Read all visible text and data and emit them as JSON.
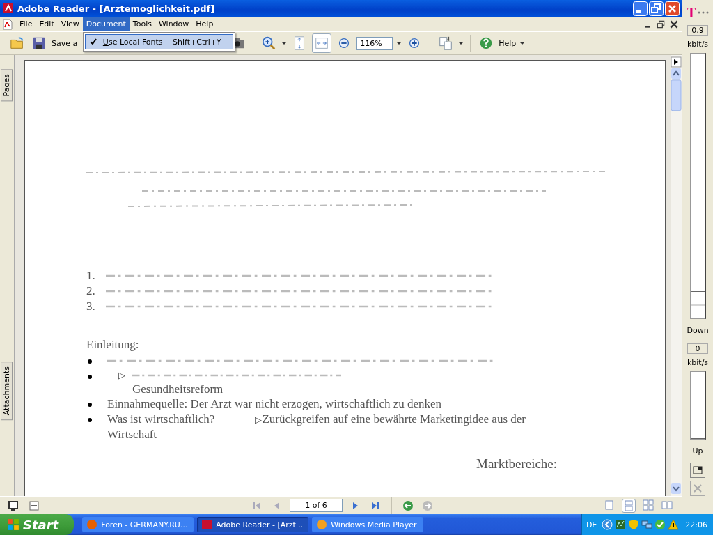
{
  "window": {
    "title": "Adobe Reader - [Arztemoglichkeit.pdf]"
  },
  "menu": [
    {
      "label": "File",
      "selected": false
    },
    {
      "label": "Edit",
      "selected": false
    },
    {
      "label": "View",
      "selected": false
    },
    {
      "label": "Document",
      "selected": true
    },
    {
      "label": "Tools",
      "selected": false
    },
    {
      "label": "Window",
      "selected": false
    },
    {
      "label": "Help",
      "selected": false
    }
  ],
  "dropdown": {
    "items": [
      {
        "label": "Use Local Fonts",
        "shortcut": "Shift+Ctrl+Y",
        "checked": true
      }
    ]
  },
  "toolbar": {
    "save_label": "Save a",
    "zoom": "116%",
    "help": "Help"
  },
  "side_tabs": [
    "Pages",
    "Attachments"
  ],
  "document": {
    "numbers": [
      "1.",
      "2.",
      "3."
    ],
    "heading": "Einleitung:",
    "bullets": [
      {
        "kind": "faded"
      },
      {
        "kind": "note",
        "arrow": "▷",
        "note": "Gesundheitsreform"
      },
      {
        "kind": "text",
        "text": "Einnahmequelle: Der Arzt war nicht erzogen, wirtschaftlich zu denken"
      },
      {
        "kind": "split",
        "text": "Was ist wirtschaftlich?",
        "arrow": "▷",
        "continuation": "Zurückgreifen auf eine bewährte Marketingidee aus der",
        "wrap": "Wirtschaft"
      }
    ],
    "right_heading": "Marktbereiche:"
  },
  "pager": {
    "page": "1 of 6"
  },
  "meter": {
    "brand": "T",
    "down": {
      "reading": "0,9",
      "unit": "kbit/s",
      "label": "Down",
      "level": 0.1
    },
    "up": {
      "reading": "0",
      "unit": "kbit/s",
      "label": "Up",
      "level": 0
    }
  },
  "taskbar": {
    "start": "Start",
    "tasks": [
      {
        "label": "Foren - GERMANY.RU...",
        "selected": false
      },
      {
        "label": "Adobe Reader - [Arzt...",
        "selected": true
      },
      {
        "label": "Windows Media Player",
        "selected": false
      }
    ],
    "language": "DE",
    "clock": "22:06"
  }
}
